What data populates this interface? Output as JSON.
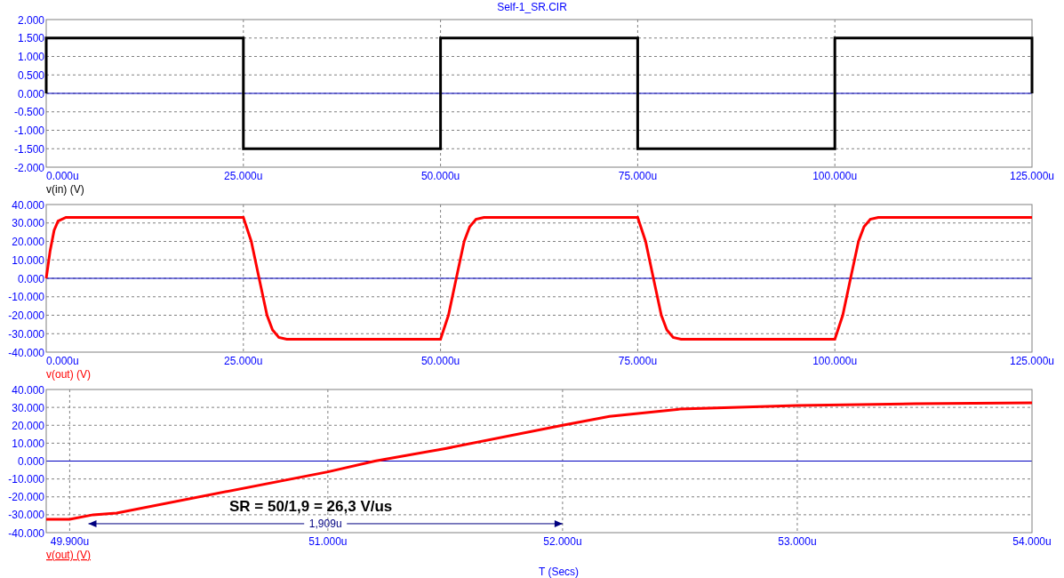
{
  "title": "Self-1_SR.CIR",
  "panels": [
    {
      "trace_selected": false,
      "chart_data": {
        "type": "line",
        "grid": true,
        "x": [
          0,
          0,
          25,
          25,
          50,
          50,
          75,
          75,
          100,
          100,
          125,
          125
        ],
        "series": [
          {
            "name": "v(in) (V)",
            "color": "#000000",
            "values": [
              0,
              1.5,
              1.5,
              -1.5,
              -1.5,
              1.5,
              1.5,
              -1.5,
              -1.5,
              1.5,
              1.5,
              0
            ]
          }
        ],
        "xlim": [
          0,
          125
        ],
        "ylim": [
          -2,
          2
        ],
        "xticks": [
          {
            "value": 0,
            "label": "0.000u"
          },
          {
            "value": 25,
            "label": "25.000u"
          },
          {
            "value": 50,
            "label": "50.000u"
          },
          {
            "value": 75,
            "label": "75.000u"
          },
          {
            "value": 100,
            "label": "100.000u"
          },
          {
            "value": 125,
            "label": "125.000u"
          }
        ],
        "yticks": [
          {
            "value": 2,
            "label": "2.000"
          },
          {
            "value": 1.5,
            "label": "1.500"
          },
          {
            "value": 1,
            "label": "1.000"
          },
          {
            "value": 0.5,
            "label": "0.500"
          },
          {
            "value": 0,
            "label": "0.000"
          },
          {
            "value": -0.5,
            "label": "-0.500"
          },
          {
            "value": -1,
            "label": "-1.000"
          },
          {
            "value": -1.5,
            "label": "-1.500"
          },
          {
            "value": -2,
            "label": "-2.000"
          }
        ],
        "ref_lines": [
          {
            "axis": "y",
            "value": 0,
            "color": "#0000c0"
          }
        ]
      }
    },
    {
      "trace_selected": false,
      "chart_data": {
        "type": "line",
        "grid": true,
        "x": [
          0,
          0.5,
          1,
          1.5,
          2.5,
          25,
          26,
          27,
          28,
          28.7,
          29.5,
          30.5,
          50,
          51,
          52,
          53,
          53.7,
          54.5,
          55.5,
          75,
          76,
          77,
          78,
          78.7,
          79.5,
          80.5,
          100,
          101,
          102,
          103,
          103.7,
          104.5,
          105.5,
          125
        ],
        "series": [
          {
            "name": "v(out) (V)",
            "color": "#ff0000",
            "values": [
              0,
              15,
              26,
              31,
              33,
              33,
              20,
              0,
              -20,
              -28,
              -32,
              -33,
              -33,
              -20,
              0,
              20,
              28,
              32,
              33,
              33,
              20,
              0,
              -20,
              -28,
              -32,
              -33,
              -33,
              -20,
              0,
              20,
              28,
              32,
              33,
              33
            ]
          }
        ],
        "xlim": [
          0,
          125
        ],
        "ylim": [
          -40,
          40
        ],
        "xticks": [
          {
            "value": 0,
            "label": "0.000u"
          },
          {
            "value": 25,
            "label": "25.000u"
          },
          {
            "value": 50,
            "label": "50.000u"
          },
          {
            "value": 75,
            "label": "75.000u"
          },
          {
            "value": 100,
            "label": "100.000u"
          },
          {
            "value": 125,
            "label": "125.000u"
          }
        ],
        "yticks": [
          {
            "value": 40,
            "label": "40.000"
          },
          {
            "value": 30,
            "label": "30.000"
          },
          {
            "value": 20,
            "label": "20.000"
          },
          {
            "value": 10,
            "label": "10.000"
          },
          {
            "value": 0,
            "label": "0.000"
          },
          {
            "value": -10,
            "label": "-10.000"
          },
          {
            "value": -20,
            "label": "-20.000"
          },
          {
            "value": -30,
            "label": "-30.000"
          },
          {
            "value": -40,
            "label": "-40.000"
          }
        ],
        "ref_lines": [
          {
            "axis": "y",
            "value": 0,
            "color": "#0000c0"
          }
        ]
      }
    },
    {
      "trace_selected": true,
      "chart_data": {
        "type": "line",
        "grid": true,
        "x": [
          49.8,
          49.9,
          50.0,
          50.1,
          51,
          51.2,
          51.5,
          52,
          52.2,
          52.5,
          53,
          53.5,
          54
        ],
        "series": [
          {
            "name": "v(out) (V)",
            "color": "#ff0000",
            "values": [
              -32.5,
              -32.5,
              -30,
              -29,
              -6,
              0,
              7,
              20,
              25,
              29,
              31,
              32,
              32.5
            ]
          }
        ],
        "xlim": [
          49.8,
          54
        ],
        "ylim": [
          -40,
          40
        ],
        "xticks": [
          {
            "value": 49.9,
            "label": "49.900u"
          },
          {
            "value": 51,
            "label": "51.000u"
          },
          {
            "value": 52,
            "label": "52.000u"
          },
          {
            "value": 53,
            "label": "53.000u"
          },
          {
            "value": 54,
            "label": "54.000u"
          }
        ],
        "yticks": [
          {
            "value": 40,
            "label": "40.000"
          },
          {
            "value": 30,
            "label": "30.000"
          },
          {
            "value": 20,
            "label": "20.000"
          },
          {
            "value": 10,
            "label": "10.000"
          },
          {
            "value": 0,
            "label": "0.000"
          },
          {
            "value": -10,
            "label": "-10.000"
          },
          {
            "value": -20,
            "label": "-20.000"
          },
          {
            "value": -30,
            "label": "-30.000"
          },
          {
            "value": -40,
            "label": "-40.000"
          }
        ],
        "ref_lines": [
          {
            "axis": "y",
            "value": 0,
            "color": "#0000c0"
          }
        ],
        "annotations": [
          "SR = 50/1,9 = 26,3 V/us",
          "1,909u"
        ]
      }
    }
  ],
  "xaxis_label": "T (Secs)"
}
